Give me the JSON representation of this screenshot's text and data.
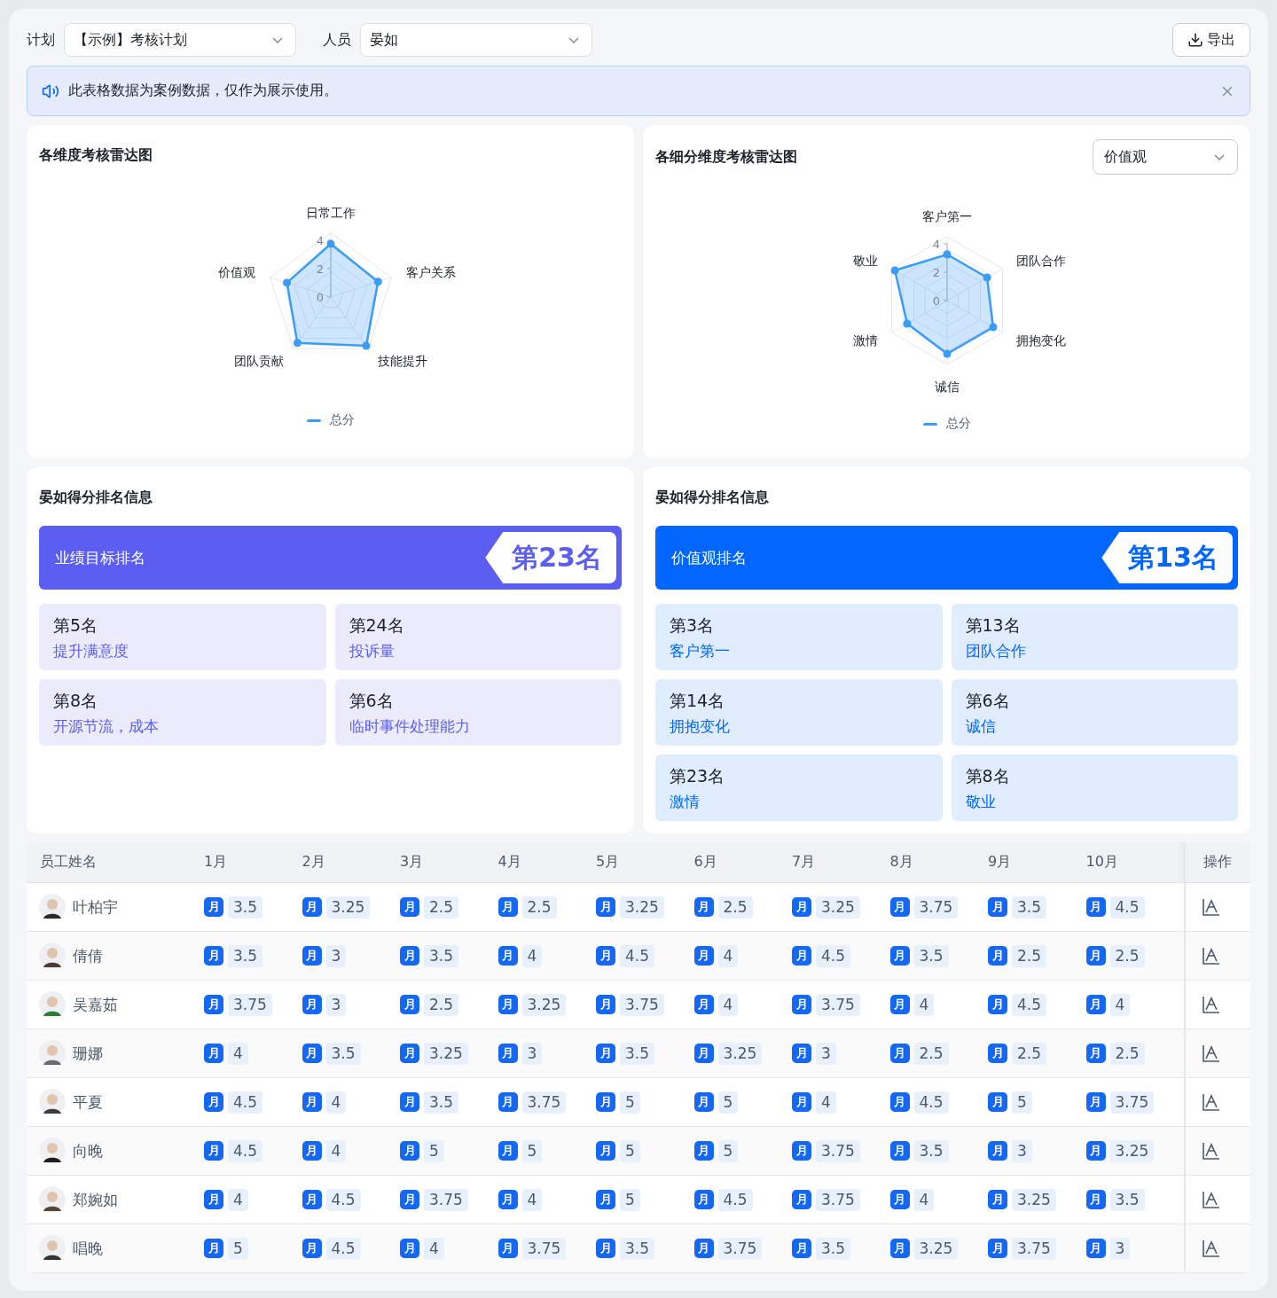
{
  "filters": [
    {
      "label": "计划",
      "value": "【示例】考核计划"
    },
    {
      "label": "人员",
      "value": "晏如"
    }
  ],
  "export_button": "导出",
  "notice": {
    "text": "此表格数据为案例数据，仅作为展示使用。"
  },
  "radar_panels": [
    {
      "title": "各维度考核雷达图",
      "chart_data": {
        "type": "radar",
        "categories": [
          "日常工作",
          "客户关系",
          "技能提升",
          "团队贡献",
          "价值观"
        ],
        "ylim": [
          0,
          4.5
        ],
        "yticks": [
          0,
          2,
          4
        ],
        "series": [
          {
            "name": "总分",
            "color": "#3a9cf8",
            "values": [
              3.75,
              3.5,
              4.25,
              4,
              3.25
            ]
          }
        ]
      }
    },
    {
      "title": "各细分维度考核雷达图",
      "select": "价值观",
      "chart_data": {
        "type": "radar",
        "categories": [
          "客户第一",
          "团队合作",
          "拥抱变化",
          "诚信",
          "激情",
          "敬业"
        ],
        "ylim": [
          0,
          4.5
        ],
        "yticks": [
          0,
          2,
          4
        ],
        "series": [
          {
            "name": "总分",
            "color": "#3a9cf8",
            "values": [
              3.25,
              3.25,
              3.75,
              3.75,
              3.25,
              4.25
            ]
          }
        ]
      }
    }
  ],
  "ranking_panels": [
    {
      "title": "晏如得分排名信息",
      "color": "#5b5ef0",
      "banner": {
        "label": "业绩目标排名",
        "rank": "第23名"
      },
      "items": [
        {
          "rank": "第5名",
          "label": "提升满意度"
        },
        {
          "rank": "第24名",
          "label": "投诉量"
        },
        {
          "rank": "第8名",
          "label": "开源节流，成本"
        },
        {
          "rank": "第6名",
          "label": "临时事件处理能力"
        }
      ]
    },
    {
      "title": "晏如得分排名信息",
      "color": "#0066ff",
      "banner": {
        "label": "价值观排名",
        "rank": "第13名"
      },
      "items": [
        {
          "rank": "第3名",
          "label": "客户第一"
        },
        {
          "rank": "第13名",
          "label": "团队合作"
        },
        {
          "rank": "第14名",
          "label": "拥抱变化"
        },
        {
          "rank": "第6名",
          "label": "诚信"
        },
        {
          "rank": "第23名",
          "label": "激情"
        },
        {
          "rank": "第8名",
          "label": "敬业"
        }
      ]
    }
  ],
  "table": {
    "name_column": "员工姓名",
    "month_columns": [
      "1月",
      "2月",
      "3月",
      "4月",
      "5月",
      "6月",
      "7月",
      "8月",
      "9月",
      "10月"
    ],
    "action_column": "操作",
    "rows": [
      {
        "name": "叶柏宇",
        "cells": [
          {
            "tag": "月",
            "score": "3.5"
          },
          {
            "tag": "月",
            "score": "3.25"
          },
          {
            "tag": "月",
            "score": "2.5"
          },
          {
            "tag": "月",
            "score": "2.5"
          },
          {
            "tag": "月",
            "score": "3.25"
          },
          {
            "tag": "月",
            "score": "2.5"
          },
          {
            "tag": "月",
            "score": "3.25"
          },
          {
            "tag": "月",
            "score": "3.75"
          },
          {
            "tag": "月",
            "score": "3.5"
          },
          {
            "tag": "月",
            "score": "4.5"
          }
        ]
      },
      {
        "name": "倩倩",
        "cells": [
          {
            "tag": "月",
            "score": "3.5"
          },
          {
            "tag": "月",
            "score": "3"
          },
          {
            "tag": "月",
            "score": "3.5"
          },
          {
            "tag": "月",
            "score": "4"
          },
          {
            "tag": "月",
            "score": "4.5"
          },
          {
            "tag": "月",
            "score": "4"
          },
          {
            "tag": "月",
            "score": "4.5"
          },
          {
            "tag": "月",
            "score": "3.5"
          },
          {
            "tag": "月",
            "score": "2.5"
          },
          {
            "tag": "月",
            "score": "2.5"
          }
        ]
      },
      {
        "name": "吴嘉茹",
        "cells": [
          {
            "tag": "月",
            "score": "3.75"
          },
          {
            "tag": "月",
            "score": "3"
          },
          {
            "tag": "月",
            "score": "2.5"
          },
          {
            "tag": "月",
            "score": "3.25"
          },
          {
            "tag": "月",
            "score": "3.75"
          },
          {
            "tag": "月",
            "score": "4"
          },
          {
            "tag": "月",
            "score": "3.75"
          },
          {
            "tag": "月",
            "score": "4"
          },
          {
            "tag": "月",
            "score": "4.5"
          },
          {
            "tag": "月",
            "score": "4"
          }
        ]
      },
      {
        "name": "珊娜",
        "cells": [
          {
            "tag": "月",
            "score": "4"
          },
          {
            "tag": "月",
            "score": "3.5"
          },
          {
            "tag": "月",
            "score": "3.25"
          },
          {
            "tag": "月",
            "score": "3"
          },
          {
            "tag": "月",
            "score": "3.5"
          },
          {
            "tag": "月",
            "score": "3.25"
          },
          {
            "tag": "月",
            "score": "3"
          },
          {
            "tag": "月",
            "score": "2.5"
          },
          {
            "tag": "月",
            "score": "2.5"
          },
          {
            "tag": "月",
            "score": "2.5"
          }
        ]
      },
      {
        "name": "平夏",
        "cells": [
          {
            "tag": "月",
            "score": "4.5"
          },
          {
            "tag": "月",
            "score": "4"
          },
          {
            "tag": "月",
            "score": "3.5"
          },
          {
            "tag": "月",
            "score": "3.75"
          },
          {
            "tag": "月",
            "score": "5"
          },
          {
            "tag": "月",
            "score": "5"
          },
          {
            "tag": "月",
            "score": "4"
          },
          {
            "tag": "月",
            "score": "4.5"
          },
          {
            "tag": "月",
            "score": "5"
          },
          {
            "tag": "月",
            "score": "3.75"
          }
        ]
      },
      {
        "name": "向晚",
        "cells": [
          {
            "tag": "月",
            "score": "4.5"
          },
          {
            "tag": "月",
            "score": "4"
          },
          {
            "tag": "月",
            "score": "5"
          },
          {
            "tag": "月",
            "score": "5"
          },
          {
            "tag": "月",
            "score": "5"
          },
          {
            "tag": "月",
            "score": "5"
          },
          {
            "tag": "月",
            "score": "3.75"
          },
          {
            "tag": "月",
            "score": "3.5"
          },
          {
            "tag": "月",
            "score": "3"
          },
          {
            "tag": "月",
            "score": "3.25"
          }
        ]
      },
      {
        "name": "郑婉如",
        "cells": [
          {
            "tag": "月",
            "score": "4"
          },
          {
            "tag": "月",
            "score": "4.5"
          },
          {
            "tag": "月",
            "score": "3.75"
          },
          {
            "tag": "月",
            "score": "4"
          },
          {
            "tag": "月",
            "score": "5"
          },
          {
            "tag": "月",
            "score": "4.5"
          },
          {
            "tag": "月",
            "score": "3.75"
          },
          {
            "tag": "月",
            "score": "4"
          },
          {
            "tag": "月",
            "score": "3.25"
          },
          {
            "tag": "月",
            "score": "3.5"
          }
        ]
      },
      {
        "name": "唱晚",
        "cells": [
          {
            "tag": "月",
            "score": "5"
          },
          {
            "tag": "月",
            "score": "4.5"
          },
          {
            "tag": "月",
            "score": "4"
          },
          {
            "tag": "月",
            "score": "3.75"
          },
          {
            "tag": "月",
            "score": "3.5"
          },
          {
            "tag": "月",
            "score": "3.75"
          },
          {
            "tag": "月",
            "score": "3.5"
          },
          {
            "tag": "月",
            "score": "3.25"
          },
          {
            "tag": "月",
            "score": "3.75"
          },
          {
            "tag": "月",
            "score": "3"
          }
        ]
      }
    ]
  }
}
